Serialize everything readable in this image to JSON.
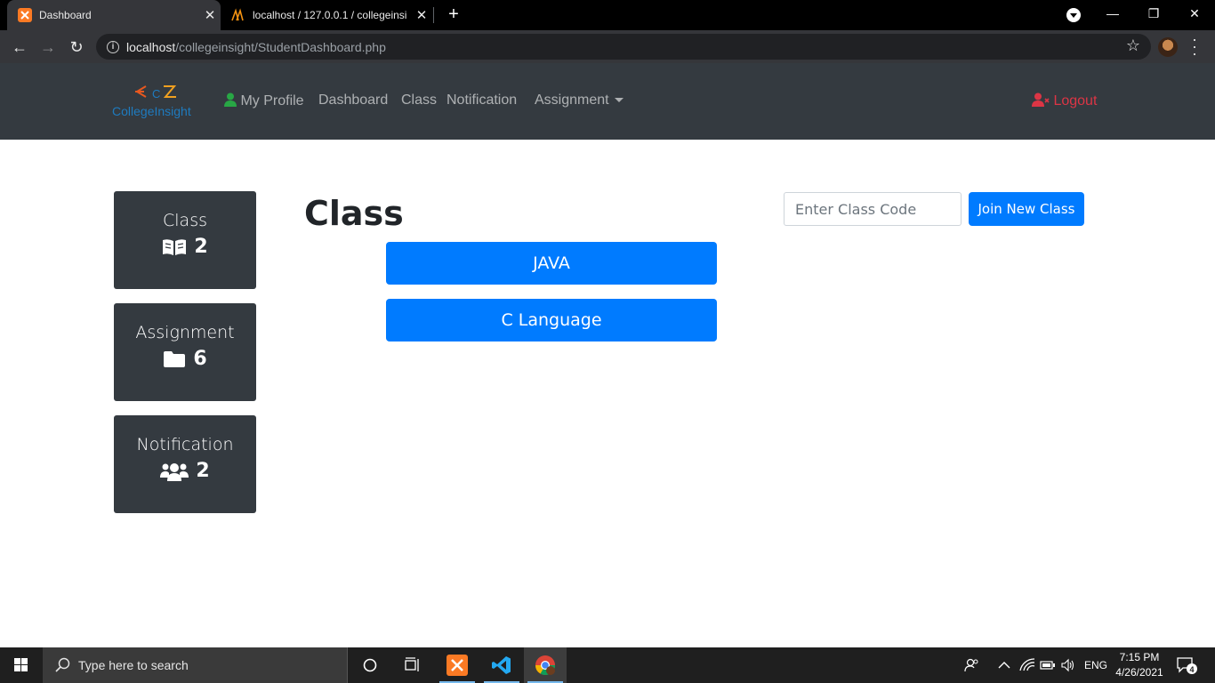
{
  "browser": {
    "tabs": [
      {
        "title": "Dashboard",
        "active": true
      },
      {
        "title": "localhost / 127.0.0.1 / collegeinsi",
        "active": false
      }
    ],
    "url_host": "localhost",
    "url_path": "/collegeinsight/StudentDashboard.php"
  },
  "navbar": {
    "brand_text": "CollegeInsight",
    "links": [
      "My Profile",
      "Dashboard",
      "Class",
      "Notification",
      "Assignment"
    ],
    "logout": "Logout",
    "colors": {
      "bg": "#343a40",
      "logout": "#dc3545",
      "profile_icon": "#28a745"
    }
  },
  "sidebar": {
    "cards": [
      {
        "label": "Class",
        "count": "2",
        "icon": "book-open-icon"
      },
      {
        "label": "Assignment",
        "count": "6",
        "icon": "folder-icon"
      },
      {
        "label": "Notification",
        "count": "2",
        "icon": "users-icon"
      }
    ]
  },
  "main": {
    "title": "Class",
    "classes": [
      "JAVA",
      "C Language"
    ],
    "join_placeholder": "Enter Class Code",
    "join_button": "Join New Class",
    "accent": "#007bff"
  },
  "taskbar": {
    "search_placeholder": "Type here to search",
    "language": "ENG",
    "time": "7:15 PM",
    "date": "4/26/2021",
    "notification_count": "4"
  }
}
